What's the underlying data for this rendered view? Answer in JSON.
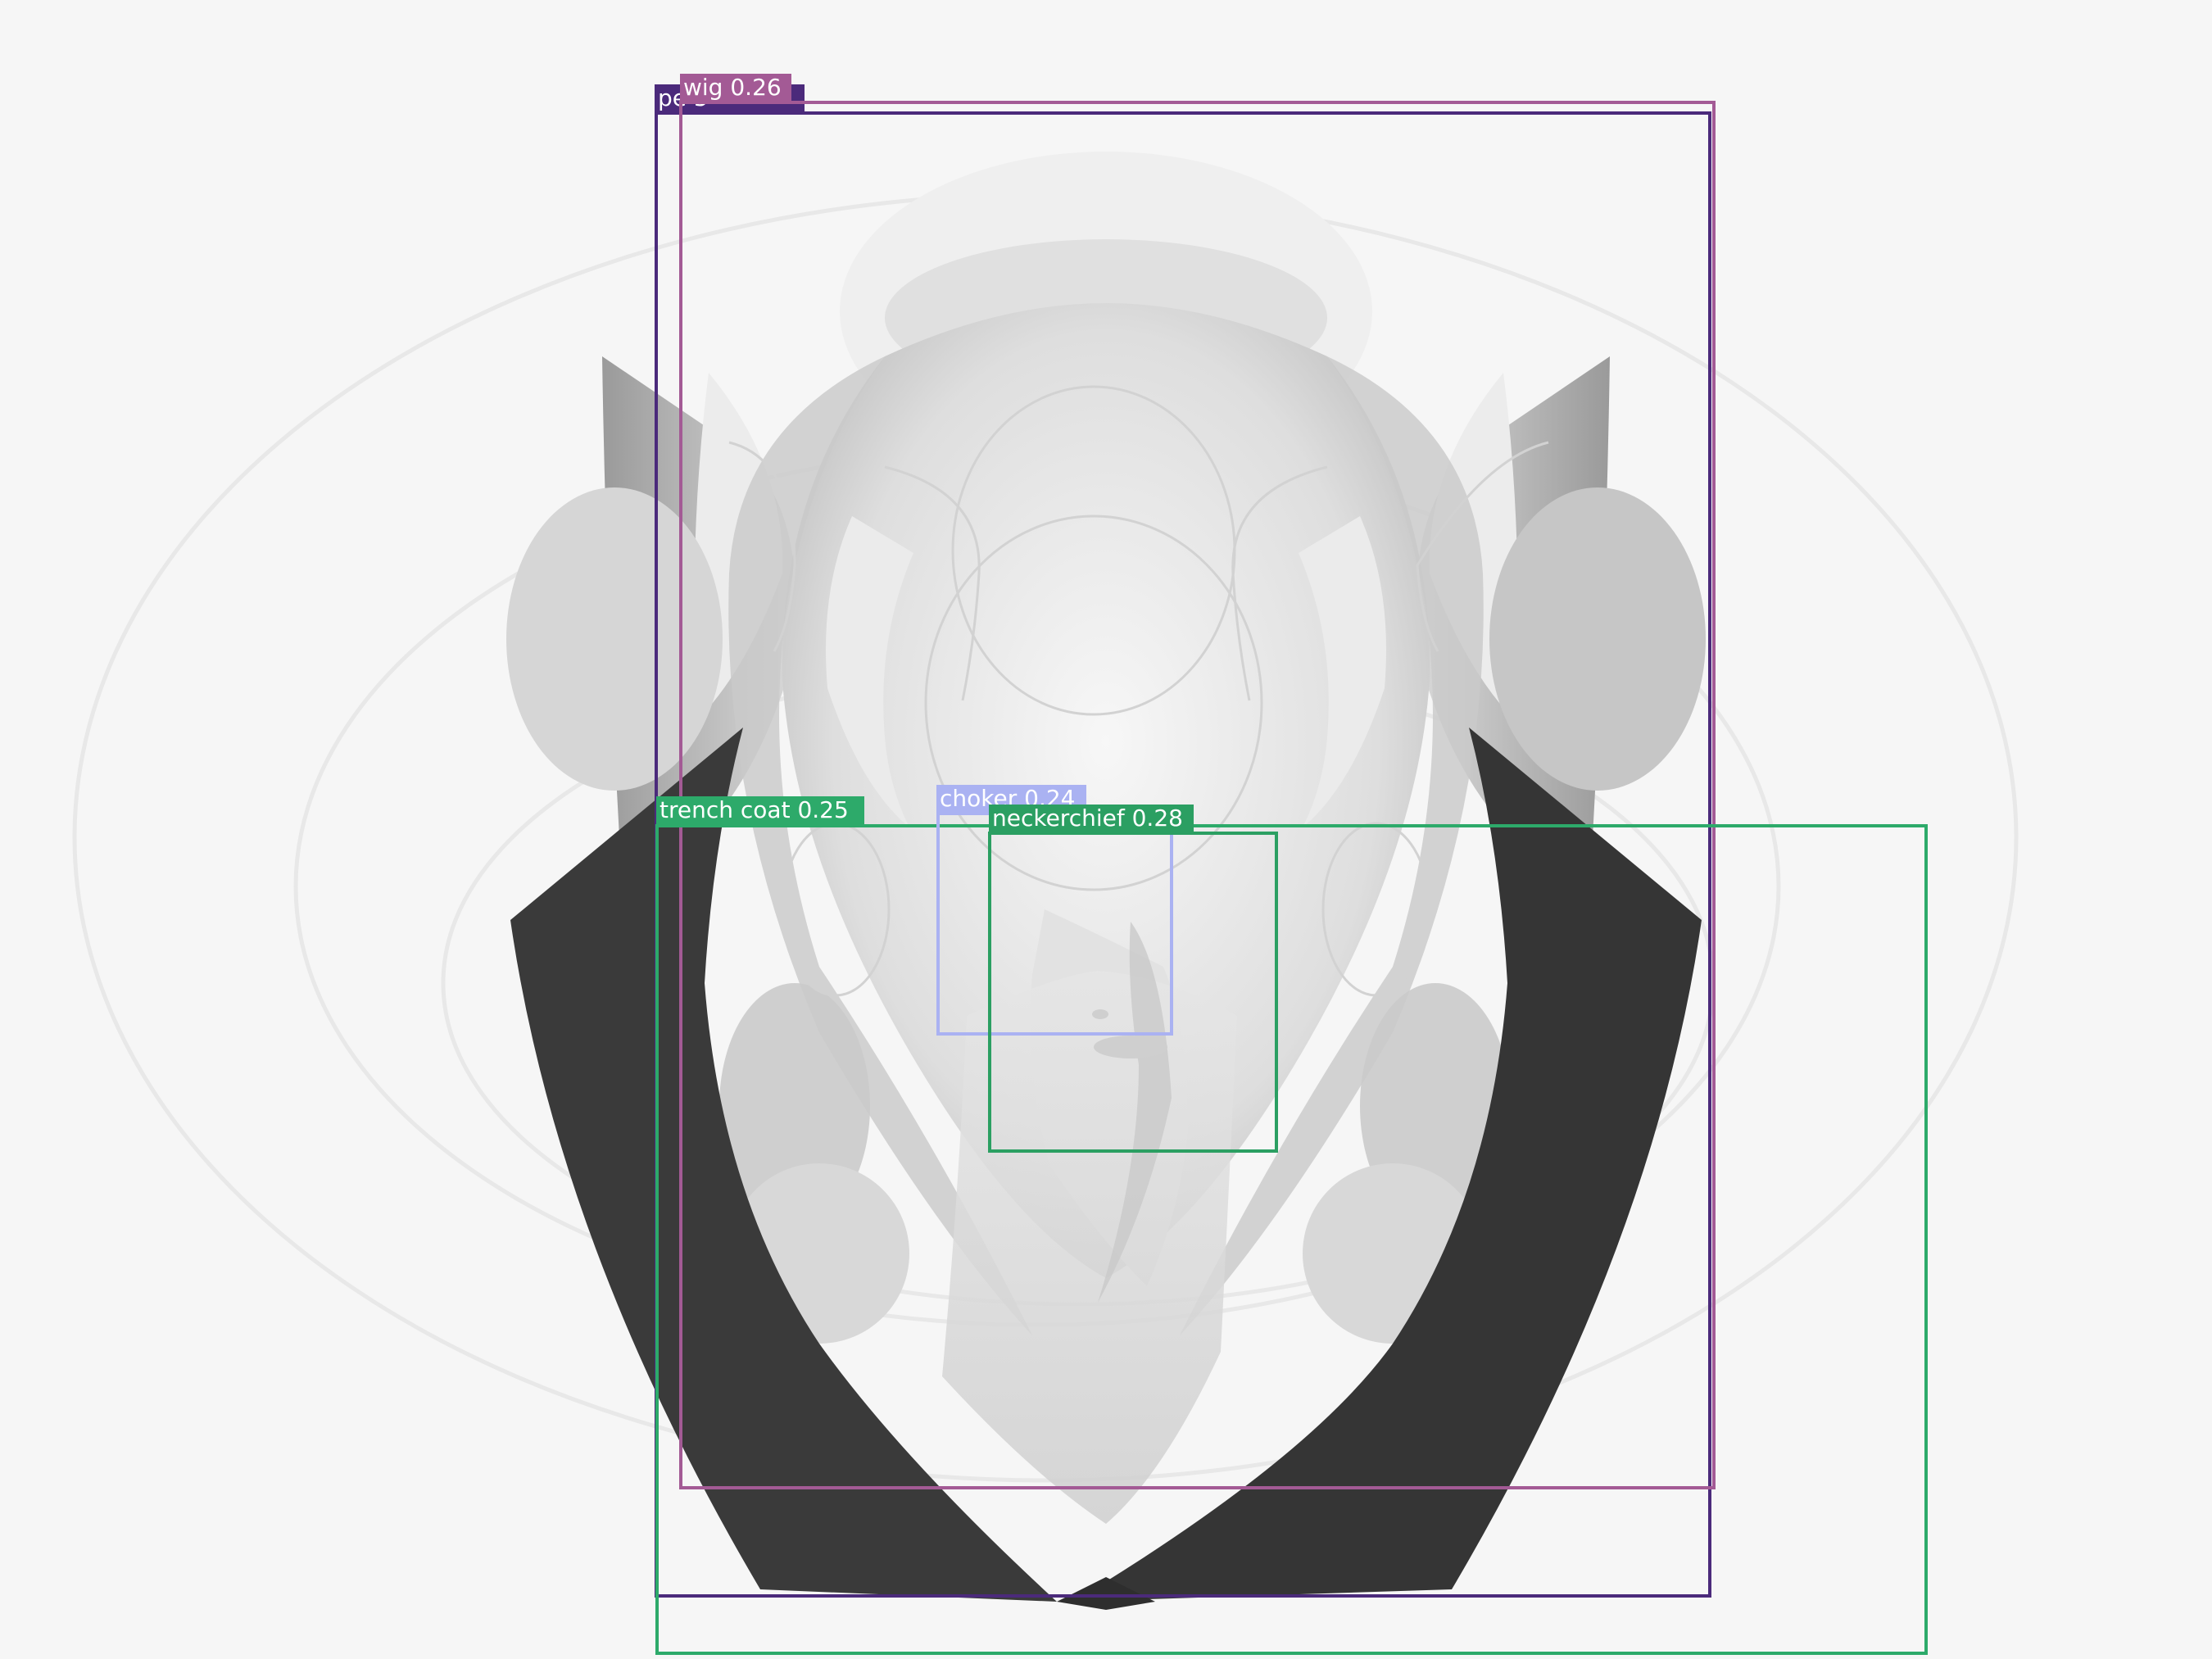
{
  "image": {
    "subject": "",
    "background_color": "#f6f6f6"
  },
  "detections": [
    {
      "label": "person",
      "score": "0.25",
      "tag_text": "pe      5",
      "color": "#4b2a7b"
    },
    {
      "label": "wig",
      "score": "0.26",
      "tag_text": "wig  0.26",
      "color": "#a35a95"
    },
    {
      "label": "trench coat",
      "score": "0.25",
      "tag_text": "trench  coat  0.25",
      "color": "#2daa6a"
    },
    {
      "label": "choker",
      "score": "0.24",
      "tag_text": "choker  0.24",
      "color": "#aab2f2"
    },
    {
      "label": "neckerchief",
      "score": "0.28",
      "tag_text": "neckerchief  0.28",
      "color": "#2b9f62"
    }
  ]
}
